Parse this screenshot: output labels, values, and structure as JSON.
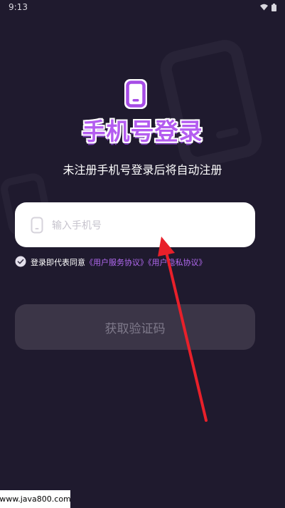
{
  "status_bar": {
    "time": "9:13",
    "wifi_icon": "wifi-icon",
    "battery_icon": "battery-icon"
  },
  "header": {
    "logo_icon": "phone-icon",
    "title": "手机号登录",
    "subtitle": "未注册手机号登录后将自动注册"
  },
  "phone_input": {
    "icon": "phone-icon",
    "placeholder": "输入手机号",
    "value": ""
  },
  "agreement": {
    "checked": true,
    "prefix": "登录即代表同意",
    "user_agreement": "《用户服务协议》",
    "privacy_policy": "《用户隐私协议》"
  },
  "get_code_button": {
    "label": "获取验证码"
  },
  "watermark": {
    "text": "www.java800.com"
  },
  "colors": {
    "background": "#1f1a2e",
    "accent": "#b45cf0",
    "link": "#b36af2",
    "button_disabled_bg": "#3b3547",
    "button_disabled_text": "#7f7a8b",
    "arrow": "#e8202a"
  }
}
